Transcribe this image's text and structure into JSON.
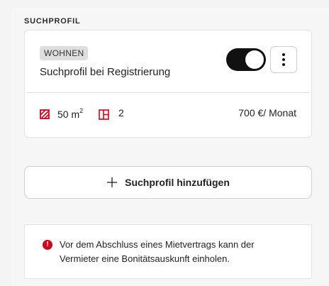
{
  "section": {
    "title": "SUCHPROFIL"
  },
  "profile": {
    "tag": "WOHNEN",
    "name": "Suchprofil bei Registrierung",
    "active": true,
    "area_value": "50 m",
    "area_unit_exp": "2",
    "rooms": "2",
    "price": "700 €/ Monat"
  },
  "actions": {
    "add_label": "Suchprofil hinzufügen"
  },
  "notice": {
    "icon": "!",
    "text": "Vor dem Abschluss eines Mietvertrags kann der Vermieter eine Bonitätsauskunft einholen."
  },
  "colors": {
    "accent_red": "#d0021b",
    "toggle_on": "#111111"
  }
}
